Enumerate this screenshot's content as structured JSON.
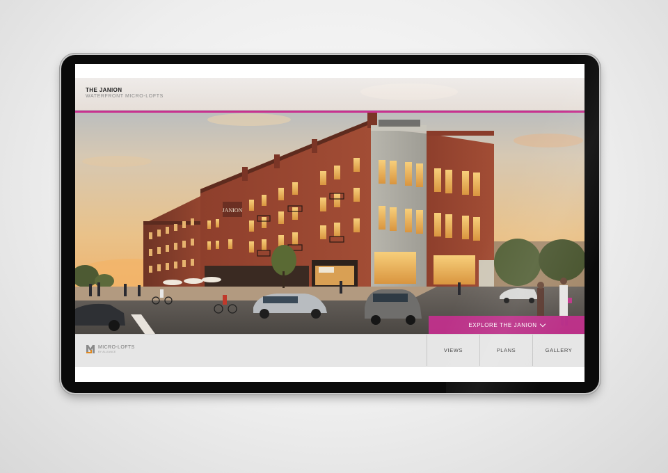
{
  "header": {
    "title": "THE JANION",
    "subtitle": "WATERFRONT MICRO-LOFTS"
  },
  "hero": {
    "sign_text": "JANION",
    "cta_label": "EXPLORE THE JANION",
    "cta_icon": "chevron-down-icon"
  },
  "footer": {
    "logo_name": "MICRO-LOFTS",
    "logo_tagline": "BY ALLIANCE",
    "nav": [
      {
        "label": "VIEWS"
      },
      {
        "label": "PLANS"
      },
      {
        "label": "GALLERY"
      }
    ]
  },
  "colors": {
    "accent": "#c8328f",
    "bezel": "#0a0a0a",
    "footer": "#e6e6e6",
    "brick": "#8e3f2c"
  }
}
